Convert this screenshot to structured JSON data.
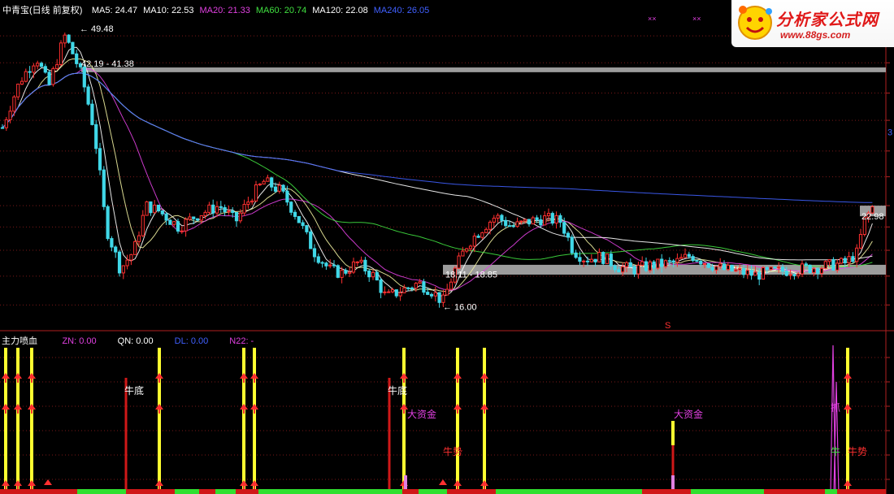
{
  "legend_main": {
    "title": "中青宝(日线 前复权)",
    "items": [
      {
        "text": "MA5: 24.47",
        "color": "#ffffff"
      },
      {
        "text": "MA10: 22.53",
        "color": "#ffffff"
      },
      {
        "text": "MA20: 21.33",
        "color": "#e040e0"
      },
      {
        "text": "MA60: 20.74",
        "color": "#40e040"
      },
      {
        "text": "MA120: 22.08",
        "color": "#ffffff"
      },
      {
        "text": "MA240: 26.05",
        "color": "#4060ff"
      }
    ]
  },
  "legend_sub": {
    "title": "主力喷血",
    "items": [
      {
        "text": "ZN: 0.00",
        "color": "#e040e0"
      },
      {
        "text": "QN: 0.00",
        "color": "#ffffff"
      },
      {
        "text": "DL: 0.00",
        "color": "#4060ff"
      },
      {
        "text": "N22: -",
        "color": "#e040e0"
      }
    ]
  },
  "brand": {
    "name": "分析家公式网",
    "url": "www.88gs.com"
  },
  "axis_right_label": "3",
  "marker_s": "S",
  "chart_data": [
    {
      "type": "candlestick",
      "title": "中青宝(日线 前复权)",
      "ylim": [
        14.5,
        52
      ],
      "y_scale": "log",
      "grid": "horizontal dotted",
      "colors": {
        "up": "#ff3030",
        "down": "#40d8e8"
      },
      "price_annotations": [
        {
          "text": "49.48",
          "value": 49.48
        },
        {
          "text": "42.19 - 41.38",
          "low": 41.38,
          "high": 42.19
        },
        {
          "text": "18.11 - 18.85",
          "low": 18.11,
          "high": 18.85
        },
        {
          "text": "16.00",
          "value": 16.0
        },
        {
          "text": "22.98",
          "value": 22.98
        }
      ],
      "zones": [
        {
          "low": 41.38,
          "high": 42.19,
          "color": "#9c9c9c"
        },
        {
          "low": 18.11,
          "high": 18.85,
          "color": "#9c9c9c"
        },
        {
          "low": 22.98,
          "high": 24.0,
          "color": "#9c9c9c"
        }
      ],
      "series": [
        {
          "name": "MA5",
          "color": "#ffffff",
          "last": 24.47
        },
        {
          "name": "MA10",
          "color": "#f0f0a0",
          "last": 22.53
        },
        {
          "name": "MA20",
          "color": "#e040e0",
          "last": 21.33
        },
        {
          "name": "MA60",
          "color": "#40e040",
          "last": 20.74
        },
        {
          "name": "MA120",
          "color": "#ffffff",
          "last": 22.08
        },
        {
          "name": "MA240",
          "color": "#4060ff",
          "last": 26.05
        }
      ]
    },
    {
      "type": "signal",
      "title": "主力喷血",
      "values": {
        "ZN": 0.0,
        "QN": 0.0,
        "DL": 0.0,
        "N22": "-"
      },
      "annotations": [
        {
          "text": "牛底",
          "color": "#ffffff"
        },
        {
          "text": "牛底",
          "color": "#ffffff"
        },
        {
          "text": "大资金",
          "color": "#e040e0"
        },
        {
          "text": "大资金",
          "color": "#e040e0"
        },
        {
          "text": "牛势",
          "color": "#ff3030"
        },
        {
          "text": "牛势",
          "color": "#ff3030"
        },
        {
          "text": "抓",
          "color": "#e040e0"
        },
        {
          "text": "牛",
          "color": "#40e040"
        }
      ]
    }
  ]
}
